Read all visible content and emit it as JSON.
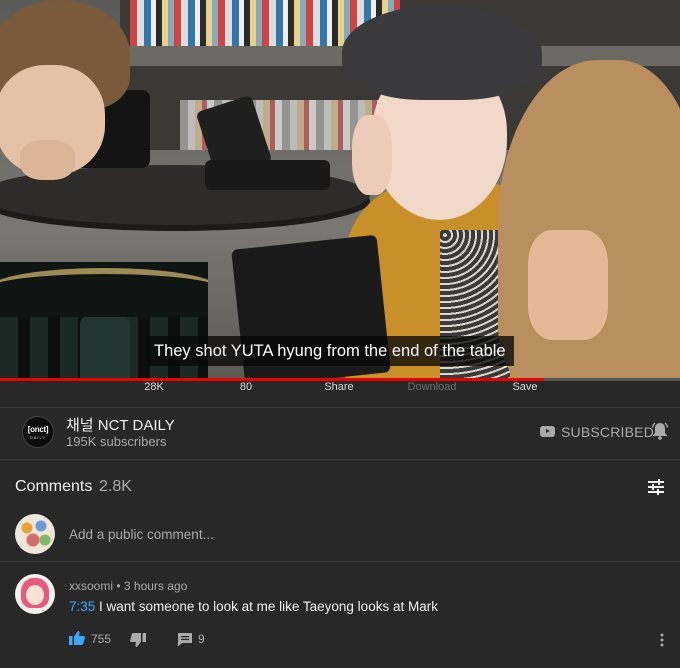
{
  "video": {
    "subtitle": "They shot YUTA hyung from the end of the table",
    "progress_fraction": 0.8
  },
  "actions": {
    "like_count": "28K",
    "dislike_count": "80",
    "share_label": "Share",
    "download_label": "Download",
    "save_label": "Save"
  },
  "channel": {
    "logo_line1": "[onct]",
    "logo_line2": "DAILY",
    "name": "채널 NCT DAILY",
    "subscribers": "195K subscribers",
    "subscribed_label": "SUBSCRIBED",
    "bell_icon": "bell-icon"
  },
  "comments": {
    "title": "Comments",
    "count": "2.8K",
    "add_placeholder": "Add a public comment...",
    "items": [
      {
        "author": "xxsoomi",
        "time": "3 hours ago",
        "timestamp_link": "7:35",
        "text": " I want someone to look at me like Taeyong looks at Mark",
        "likes": "755",
        "replies": "9"
      }
    ]
  },
  "colors": {
    "background": "#282828",
    "progress": "#ee0000",
    "link": "#3ea6ff",
    "secondary_text": "#aaaaaa"
  }
}
